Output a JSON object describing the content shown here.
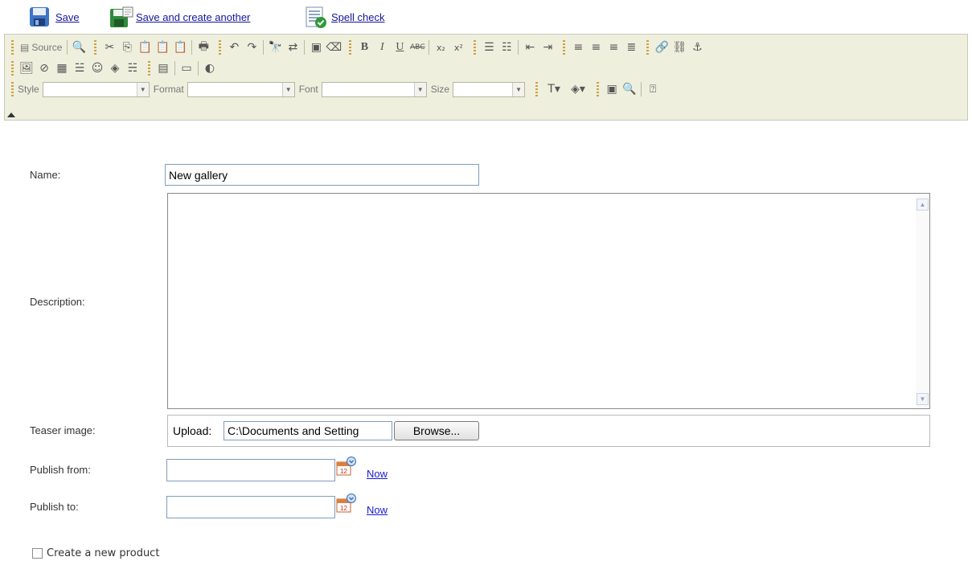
{
  "actions": {
    "save": "Save",
    "save_another": "Save and create another",
    "spell_check": "Spell check"
  },
  "toolbar": {
    "source": "Source",
    "style_label": "Style",
    "format_label": "Format",
    "font_label": "Font",
    "size_label": "Size",
    "bold": "B",
    "italic": "I",
    "underline": "U",
    "strike": "ABC"
  },
  "form": {
    "name_label": "Name:",
    "name_value": "New gallery",
    "description_label": "Description:",
    "teaser_label": "Teaser image:",
    "upload_label": "Upload:",
    "upload_value": "C:\\Documents and Setting",
    "browse": "Browse...",
    "publish_from_label": "Publish from:",
    "publish_to_label": "Publish to:",
    "now": "Now",
    "calendar_day": "12",
    "create_product": "Create a new product"
  },
  "colors": {
    "link": "#15159a",
    "toolbar_bg": "#efefde",
    "input_border": "#7f9db9"
  }
}
